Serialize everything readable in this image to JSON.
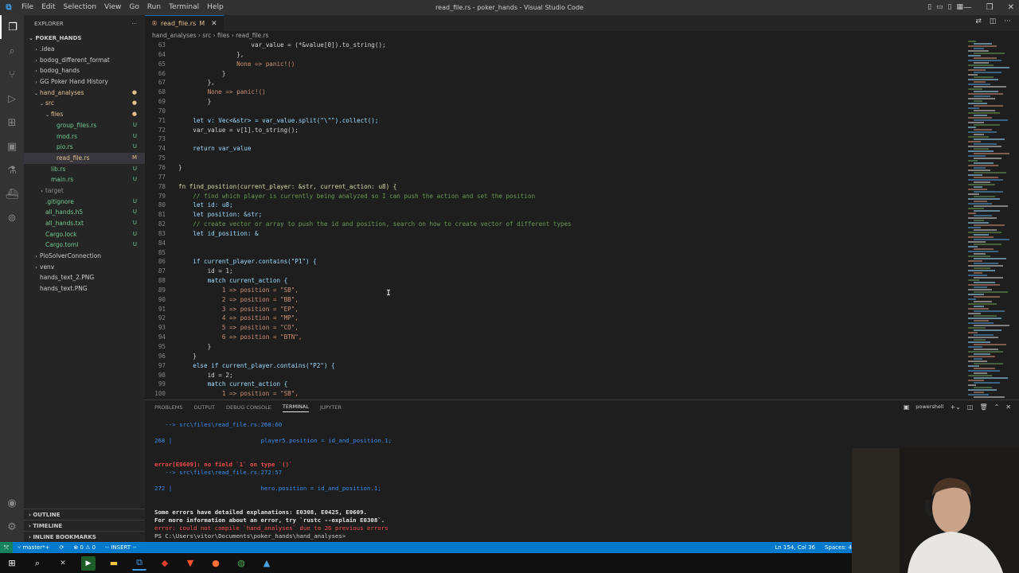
{
  "window": {
    "title": "read_file.rs - poker_hands - Visual Studio Code",
    "menu": [
      "File",
      "Edit",
      "Selection",
      "View",
      "Go",
      "Run",
      "Terminal",
      "Help"
    ]
  },
  "sidebar": {
    "header": "EXPLORER",
    "more": "···",
    "root": "POKER_HANDS",
    "items": [
      {
        "label": ".idea",
        "indent": 1,
        "twisty": "›",
        "class": "",
        "badge": ""
      },
      {
        "label": "bodog_different_format",
        "indent": 1,
        "twisty": "›",
        "class": "",
        "badge": ""
      },
      {
        "label": "bodog_hands",
        "indent": 1,
        "twisty": "›",
        "class": "",
        "badge": ""
      },
      {
        "label": "GG Poker Hand History",
        "indent": 1,
        "twisty": "›",
        "class": "",
        "badge": ""
      },
      {
        "label": "hand_analyses",
        "indent": 1,
        "twisty": "⌄",
        "class": "c-mod",
        "badge": "●"
      },
      {
        "label": "src",
        "indent": 2,
        "twisty": "⌄",
        "class": "c-mod",
        "badge": "●"
      },
      {
        "label": "files",
        "indent": 3,
        "twisty": "⌄",
        "class": "c-mod",
        "badge": "●"
      },
      {
        "label": "group_files.rs",
        "indent": 4,
        "twisty": "",
        "class": "c-new",
        "badge": "U"
      },
      {
        "label": "mod.rs",
        "indent": 4,
        "twisty": "",
        "class": "c-new",
        "badge": "U"
      },
      {
        "label": "pio.rs",
        "indent": 4,
        "twisty": "",
        "class": "c-new",
        "badge": "U"
      },
      {
        "label": "read_file.rs",
        "indent": 4,
        "twisty": "",
        "class": "c-mod",
        "badge": "M",
        "selected": true
      },
      {
        "label": "lib.rs",
        "indent": 3,
        "twisty": "",
        "class": "c-new",
        "badge": "U"
      },
      {
        "label": "main.rs",
        "indent": 3,
        "twisty": "",
        "class": "c-new",
        "badge": "U"
      },
      {
        "label": "target",
        "indent": 2,
        "twisty": "›",
        "class": "c-ign",
        "badge": ""
      },
      {
        "label": ".gitignore",
        "indent": 2,
        "twisty": "",
        "class": "c-new",
        "badge": "U"
      },
      {
        "label": "all_hands.h5",
        "indent": 2,
        "twisty": "",
        "class": "c-new",
        "badge": "U"
      },
      {
        "label": "all_hands.txt",
        "indent": 2,
        "twisty": "",
        "class": "c-new",
        "badge": "U"
      },
      {
        "label": "Cargo.lock",
        "indent": 2,
        "twisty": "",
        "class": "c-new",
        "badge": "U"
      },
      {
        "label": "Cargo.toml",
        "indent": 2,
        "twisty": "",
        "class": "c-new",
        "badge": "U"
      },
      {
        "label": "PioSolverConnection",
        "indent": 1,
        "twisty": "›",
        "class": "",
        "badge": ""
      },
      {
        "label": "venv",
        "indent": 1,
        "twisty": "›",
        "class": "",
        "badge": ""
      },
      {
        "label": "hands_text_2.PNG",
        "indent": 1,
        "twisty": "",
        "class": "",
        "badge": ""
      },
      {
        "label": "hands_text.PNG",
        "indent": 1,
        "twisty": "",
        "class": "",
        "badge": ""
      }
    ],
    "panels": [
      "› OUTLINE",
      "› TIMELINE",
      "› INLINE BOOKMARKS"
    ]
  },
  "editor": {
    "tab": {
      "label": "read_file.rs",
      "status": "M"
    },
    "breadcrumb": "hand_analyses  ›  src  ›  files  ›  read_file.rs",
    "lines": [
      {
        "n": "63",
        "t": "                    var_value = (*&value[0]).to_string();"
      },
      {
        "n": "64",
        "t": "                },"
      },
      {
        "n": "65",
        "t": "                None => panic!()"
      },
      {
        "n": "66",
        "t": "            }"
      },
      {
        "n": "67",
        "t": "        },"
      },
      {
        "n": "68",
        "t": "        None => panic!()"
      },
      {
        "n": "69",
        "t": "        }"
      },
      {
        "n": "70",
        "t": ""
      },
      {
        "n": "71",
        "t": "    let v: Vec<&str> = var_value.split(\"\\\"\").collect();"
      },
      {
        "n": "72",
        "t": "    var_value = v[1].to_string();"
      },
      {
        "n": "73",
        "t": ""
      },
      {
        "n": "74",
        "t": "    return var_value"
      },
      {
        "n": "75",
        "t": ""
      },
      {
        "n": "76",
        "t": "}"
      },
      {
        "n": "77",
        "t": ""
      },
      {
        "n": "78",
        "t": "fn find_position(current_player: &str, current_action: u8) {"
      },
      {
        "n": "79",
        "t": "    // find which player is currently being analyzed so I can push the action and set the position"
      },
      {
        "n": "80",
        "t": "    let id: u8;"
      },
      {
        "n": "81",
        "t": "    let position: &str;"
      },
      {
        "n": "82",
        "t": "    // create vector or array to push the id and position, search on how to create vector of different types"
      },
      {
        "n": "83",
        "t": "    let id_position: &"
      },
      {
        "n": "84",
        "t": ""
      },
      {
        "n": "85",
        "t": ""
      },
      {
        "n": "86",
        "t": "    if current_player.contains(\"P1\") {"
      },
      {
        "n": "87",
        "t": "        id = 1;"
      },
      {
        "n": "88",
        "t": "        match current_action {"
      },
      {
        "n": "89",
        "t": "            1 => position = \"SB\","
      },
      {
        "n": "90",
        "t": "            2 => position = \"BB\","
      },
      {
        "n": "91",
        "t": "            3 => position = \"EP\","
      },
      {
        "n": "92",
        "t": "            4 => position = \"MP\","
      },
      {
        "n": "93",
        "t": "            5 => position = \"CO\","
      },
      {
        "n": "94",
        "t": "            6 => position = \"BTN\","
      },
      {
        "n": "95",
        "t": "        }"
      },
      {
        "n": "96",
        "t": "    }"
      },
      {
        "n": "97",
        "t": "    else if current_player.contains(\"P2\") {"
      },
      {
        "n": "98",
        "t": "        id = 2;"
      },
      {
        "n": "99",
        "t": "        match current_action {"
      },
      {
        "n": "100",
        "t": "            1 => position = \"SB\","
      }
    ]
  },
  "panel": {
    "tabs": [
      "PROBLEMS",
      "OUTPUT",
      "DEBUG CONSOLE",
      "TERMINAL",
      "JUPYTER"
    ],
    "active_tab": "TERMINAL",
    "shell": "powershell",
    "terminal": [
      {
        "pre": "   --> src\\files\\read_file.rs:268:60",
        "kind": "blue"
      },
      {
        "pre": "",
        "kind": "plain"
      },
      {
        "pre": "268 |                         player5.position = id_and_position.1;",
        "kind": "blue"
      },
      {
        "pre": "",
        "kind": "plain"
      },
      {
        "pre": "",
        "kind": "plain"
      },
      {
        "pre": "error[E0609]: no field `1` on type `()`",
        "kind": "error"
      },
      {
        "pre": "   --> src\\files\\read_file.rs:272:57",
        "kind": "blue"
      },
      {
        "pre": "",
        "kind": "plain"
      },
      {
        "pre": "272 |                         hero.position = id_and_position.1;",
        "kind": "blue"
      },
      {
        "pre": "",
        "kind": "plain"
      },
      {
        "pre": "",
        "kind": "plain"
      },
      {
        "pre": "Some errors have detailed explanations: E0308, E0425, E0609.",
        "kind": "bold"
      },
      {
        "pre": "For more information about an error, try `rustc --explain E0308`.",
        "kind": "bold"
      },
      {
        "pre": "error: could not compile `hand_analyses` due to 26 previous errors",
        "kind": "err2"
      },
      {
        "pre": "PS C:\\Users\\vitor\\Documents\\poker_hands\\hand_analyses> ",
        "kind": "plain"
      }
    ]
  },
  "statusbar": {
    "branch": "master*+",
    "problems": "⊗ 0  ⚠ 0",
    "mode": "-- INSERT --",
    "position": "Ln 154, Col 36",
    "spaces": "Spaces: 4"
  },
  "colors": {
    "accent": "#007acc",
    "modified": "#e2c08d",
    "untracked": "#73c991"
  }
}
